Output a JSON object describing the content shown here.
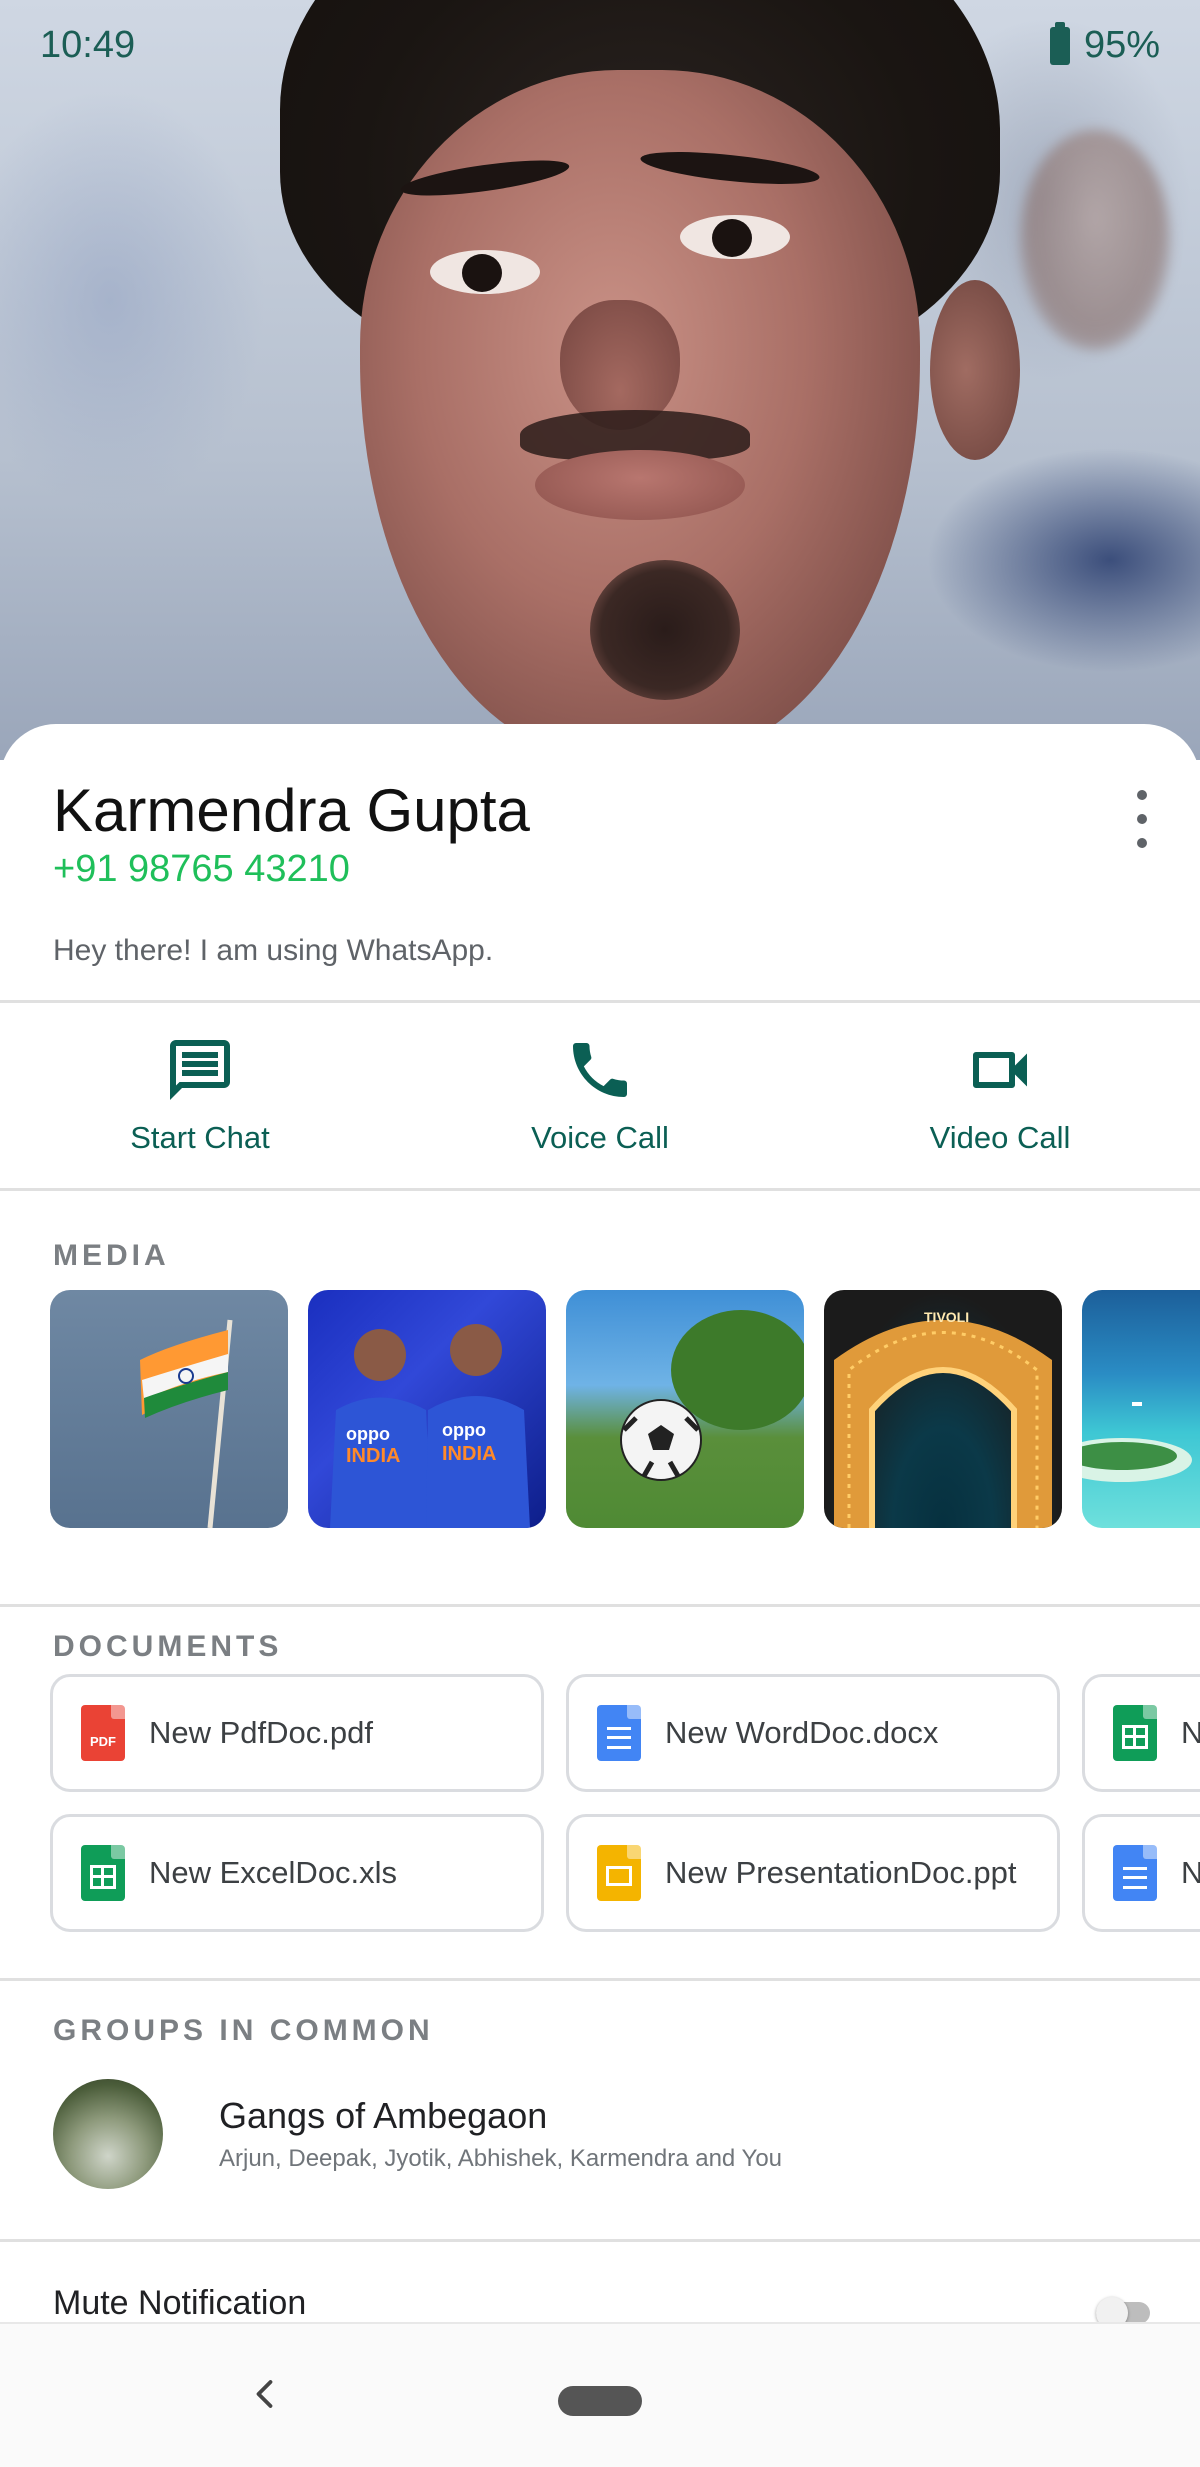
{
  "status_bar": {
    "time": "10:49",
    "battery": "95%",
    "icons": [
      "battery-icon"
    ]
  },
  "profile": {
    "name": "Karmendra Gupta",
    "phone": "+91 98765 43210",
    "about": "Hey there! I am using WhatsApp.",
    "icons": [
      "more-vert-icon"
    ]
  },
  "actions": [
    {
      "label": "Start Chat",
      "icon": "chat-icon"
    },
    {
      "label": "Voice Call",
      "icon": "phone-icon"
    },
    {
      "label": "Video Call",
      "icon": "video-icon"
    }
  ],
  "media": {
    "title": "MEDIA",
    "items": [
      "indian-flag",
      "cricket-players",
      "football",
      "illuminated-arch",
      "tropical-beach"
    ]
  },
  "documents": {
    "title": "DOCUMENTS",
    "rows": [
      [
        {
          "name": "New PdfDoc.pdf",
          "type": "pdf",
          "badge": "PDF"
        },
        {
          "name": "New WordDoc.docx",
          "type": "doc"
        },
        {
          "name": "N",
          "type": "xls"
        }
      ],
      [
        {
          "name": "New ExcelDoc.xls",
          "type": "xls"
        },
        {
          "name": "New PresentationDoc.ppt",
          "type": "ppt"
        },
        {
          "name": "N",
          "type": "doc"
        }
      ]
    ]
  },
  "groups": {
    "title": "GROUPS IN COMMON",
    "items": [
      {
        "name": "Gangs of Ambegaon",
        "members": "Arjun, Deepak, Jyotik, Abhishek, Karmendra and You"
      }
    ]
  },
  "settings": {
    "mute_label": "Mute Notification",
    "mute_on": false
  },
  "colors": {
    "accent": "#0b5f54",
    "phone": "#1fbf5a",
    "divider": "#e0e0e0"
  }
}
